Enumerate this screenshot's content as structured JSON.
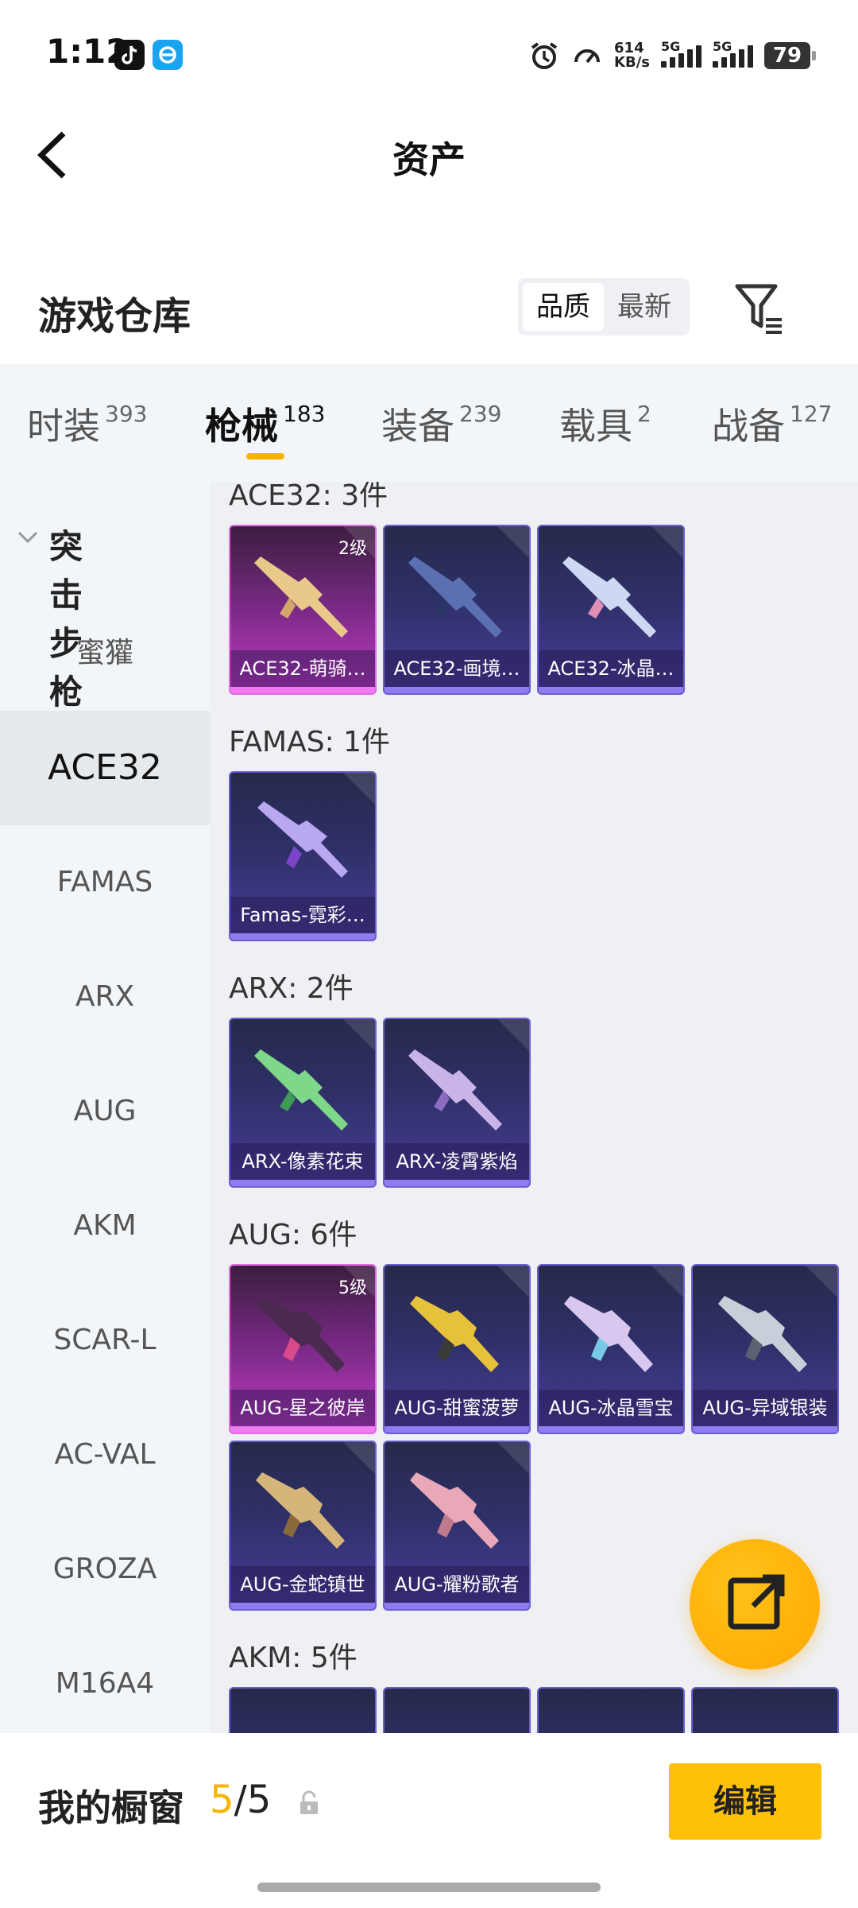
{
  "status_bar": {
    "time": "1:12",
    "net_speed": "614",
    "net_unit": "KB/s",
    "sig1": "5G",
    "sig2": "5G",
    "battery": "79"
  },
  "header": {
    "title": "资产"
  },
  "repo": {
    "title": "游戏仓库",
    "sort_quality": "品质",
    "sort_latest": "最新"
  },
  "tabs": [
    {
      "label": "时装",
      "count": "393"
    },
    {
      "label": "枪械",
      "count": "183"
    },
    {
      "label": "装备",
      "count": "239"
    },
    {
      "label": "载具",
      "count": "2"
    },
    {
      "label": "战备",
      "count": "127"
    }
  ],
  "sidebar": {
    "category": "突击步枪",
    "items": [
      "蜜獾",
      "ACE32",
      "FAMAS",
      "ARX",
      "AUG",
      "AKM",
      "SCAR-L",
      "AC-VAL",
      "GROZA",
      "M16A4"
    ],
    "active": "ACE32"
  },
  "groups": [
    {
      "title": "ACE32: 3件",
      "items": [
        {
          "name": "ACE32-萌骑…",
          "level": "2级",
          "rarity": "pink"
        },
        {
          "name": "ACE32-画境…",
          "level": "",
          "rarity": "purple"
        },
        {
          "name": "ACE32-冰晶…",
          "level": "",
          "rarity": "purple"
        }
      ]
    },
    {
      "title": "FAMAS: 1件",
      "items": [
        {
          "name": "Famas-霓彩…",
          "level": "",
          "rarity": "purple"
        }
      ]
    },
    {
      "title": "ARX: 2件",
      "items": [
        {
          "name": "ARX-像素花束",
          "level": "",
          "rarity": "purple"
        },
        {
          "name": "ARX-凌霄紫焰",
          "level": "",
          "rarity": "purple"
        }
      ]
    },
    {
      "title": "AUG: 6件",
      "items": [
        {
          "name": "AUG-星之彼岸",
          "level": "5级",
          "rarity": "pink"
        },
        {
          "name": "AUG-甜蜜菠萝",
          "level": "",
          "rarity": "purple"
        },
        {
          "name": "AUG-冰晶雪宝",
          "level": "",
          "rarity": "purple"
        },
        {
          "name": "AUG-异域银装",
          "level": "",
          "rarity": "purple"
        },
        {
          "name": "AUG-金蛇镇世",
          "level": "",
          "rarity": "purple"
        },
        {
          "name": "AUG-耀粉歌者",
          "level": "",
          "rarity": "purple"
        }
      ]
    },
    {
      "title": "AKM: 5件",
      "items": []
    }
  ],
  "bottom": {
    "shelf_label": "我的橱窗",
    "shelf_used": "5",
    "shelf_total": "/5",
    "edit_label": "编辑"
  },
  "colors": {
    "accent": "#f5b400",
    "pink_rarity": "#c53cc6",
    "purple_rarity": "#4a3e99"
  }
}
